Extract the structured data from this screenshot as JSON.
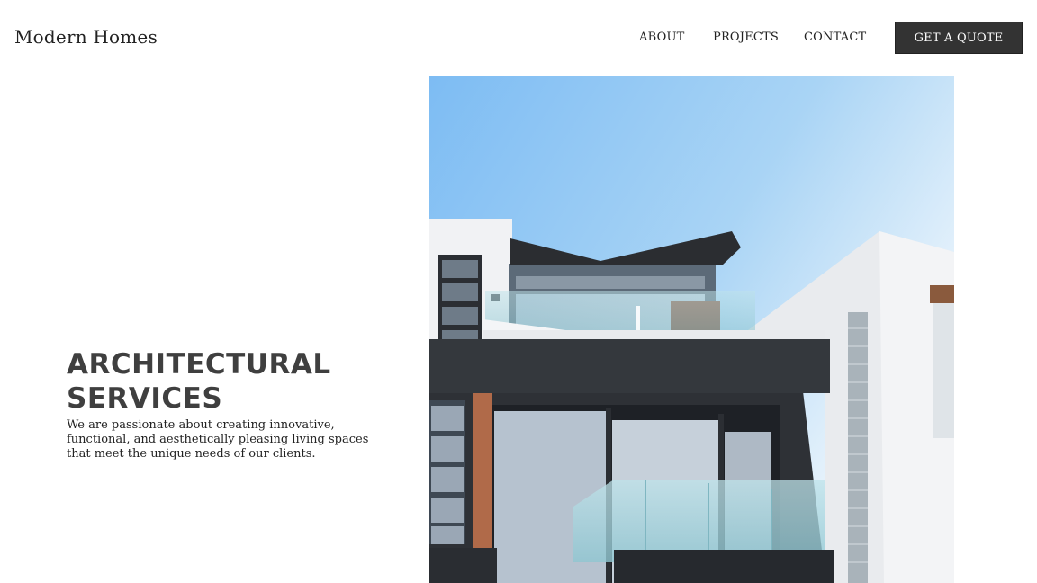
{
  "header": {
    "logo": "Modern Homes",
    "nav": [
      {
        "label": "ABOUT"
      },
      {
        "label": "PROJECTS"
      },
      {
        "label": "CONTACT"
      }
    ],
    "cta_label": "GET A QUOTE"
  },
  "hero": {
    "title_line1": "ARCHITECTURAL",
    "title_line2": "SERVICES",
    "body": "We are passionate about creating innovative, functional, and aesthetically pleasing living spaces that meet the unique needs of our clients."
  },
  "colors": {
    "cta_background": "#333333",
    "heading": "#3f3f3f",
    "sky": "#7fbef2"
  }
}
